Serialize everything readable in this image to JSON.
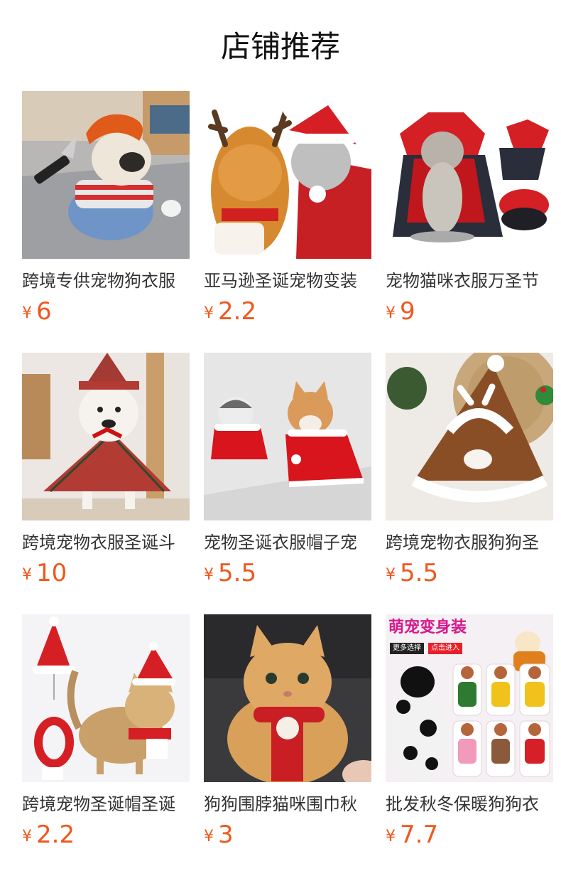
{
  "shop": {
    "title": "店铺推荐"
  },
  "colors": {
    "price": "#f0571c",
    "text": "#333333"
  },
  "products": [
    {
      "name": "跨境专供宠物狗衣服",
      "currency": "¥",
      "price": "6",
      "image": "dog-chucky-costume-image"
    },
    {
      "name": "亚马逊圣诞宠物变装",
      "currency": "¥",
      "price": "2.2",
      "image": "cats-christmas-antlers-image"
    },
    {
      "name": "宠物猫咪衣服万圣节",
      "currency": "¥",
      "price": "9",
      "image": "cat-vampire-cape-image"
    },
    {
      "name": "跨境宠物衣服圣诞斗",
      "currency": "¥",
      "price": "10",
      "image": "dog-plaid-christmas-cape-image"
    },
    {
      "name": "宠物圣诞衣服帽子宠",
      "currency": "¥",
      "price": "5.5",
      "image": "cat-dog-red-capes-image"
    },
    {
      "name": "跨境宠物衣服狗狗圣",
      "currency": "¥",
      "price": "5.5",
      "image": "brown-christmas-cape-image"
    },
    {
      "name": "跨境宠物圣诞帽圣诞",
      "currency": "¥",
      "price": "2.2",
      "image": "cat-santa-hat-scarf-image"
    },
    {
      "name": "狗狗围脖猫咪围巾秋",
      "currency": "¥",
      "price": "3",
      "image": "cat-red-knit-scarf-image"
    },
    {
      "name": "批发秋冬保暖狗狗衣",
      "currency": "¥",
      "price": "7.7",
      "image": "dog-cow-costume-collage-image"
    }
  ],
  "collage": {
    "headline": "萌宠变身装",
    "btn_more": "更多选择",
    "btn_enter": "点击进入"
  }
}
